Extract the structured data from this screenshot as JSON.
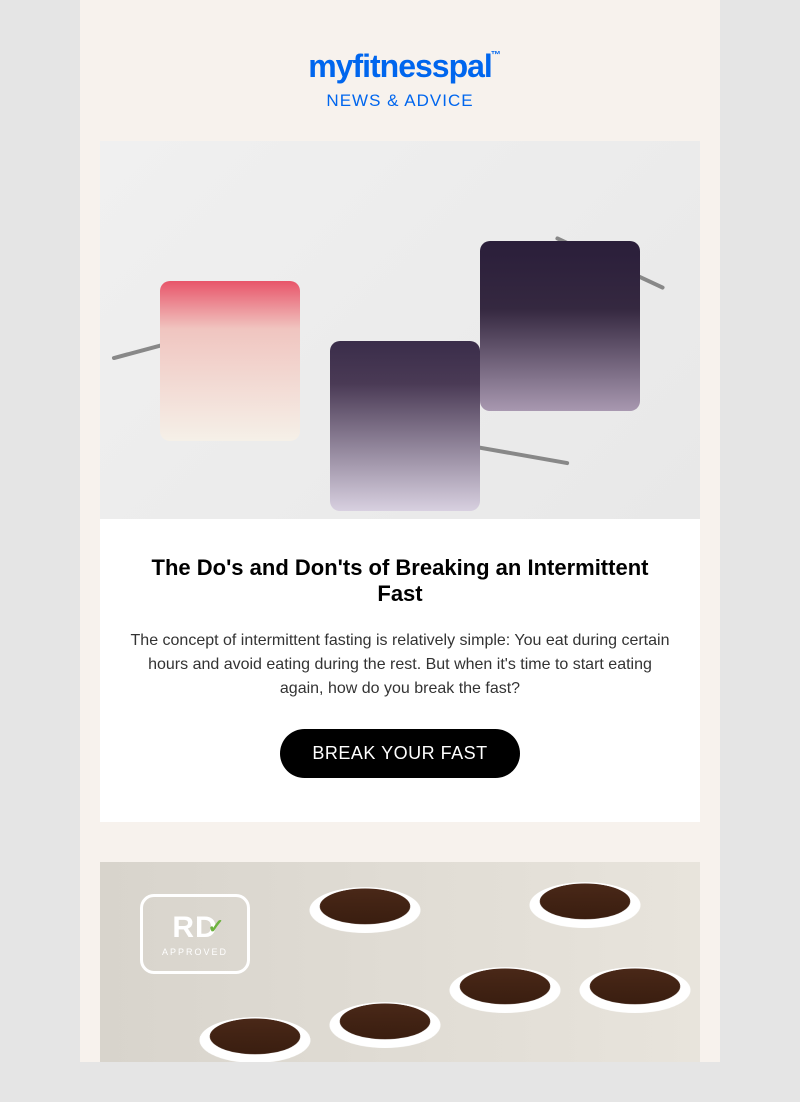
{
  "header": {
    "logo": "myfitnesspal",
    "logo_tm": "™",
    "tagline": "NEWS & ADVICE"
  },
  "article1": {
    "title": "The Do's and Don'ts of Breaking an Intermittent Fast",
    "body": "The concept of intermittent fasting is relatively simple: You eat during certain hours and avoid eating during the rest. But when it's time to start eating again, how do you break the fast?",
    "cta_label": "BREAK YOUR FAST"
  },
  "article2": {
    "badge_main": "RD",
    "badge_sub": "APPROVED"
  }
}
